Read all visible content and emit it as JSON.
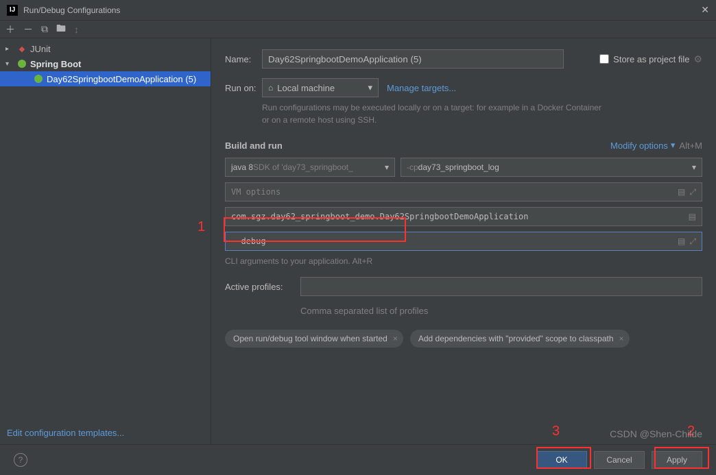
{
  "window": {
    "title": "Run/Debug Configurations"
  },
  "tree": {
    "junit": "JUnit",
    "springboot": "Spring Boot",
    "config": "Day62SpringbootDemoApplication (5)"
  },
  "form": {
    "name_label": "Name:",
    "name_value": "Day62SpringbootDemoApplication (5)",
    "store_label": "Store as project file",
    "runon_label": "Run on:",
    "runon_value": "Local machine",
    "manage_targets": "Manage targets...",
    "runon_hint": "Run configurations may be executed locally or on a target: for example in a Docker Container or on a remote host using SSH.",
    "section_build": "Build and run",
    "modify_options": "Modify options",
    "modify_shortcut": "Alt+M",
    "sdk_prefix": "java 8",
    "sdk_suffix": " SDK of 'day73_springboot_",
    "cp_prefix": "-cp ",
    "cp_value": "day73_springboot_log",
    "vm_placeholder": "VM options",
    "main_class": "com.sgz.day62_springboot_demo.Day62SpringbootDemoApplication",
    "args_value": "--debug",
    "args_hint": "CLI arguments to your application. Alt+R",
    "profiles_label": "Active profiles:",
    "profiles_hint": "Comma separated list of profiles",
    "chip1": "Open run/debug tool window when started",
    "chip2": "Add dependencies with \"provided\" scope to classpath"
  },
  "footer": {
    "edit_templates": "Edit configuration templates...",
    "ok": "OK",
    "cancel": "Cancel",
    "apply": "Apply"
  },
  "annotations": {
    "a1": "1",
    "a2": "2",
    "a3": "3"
  },
  "watermark": "CSDN @Shen-Childe"
}
